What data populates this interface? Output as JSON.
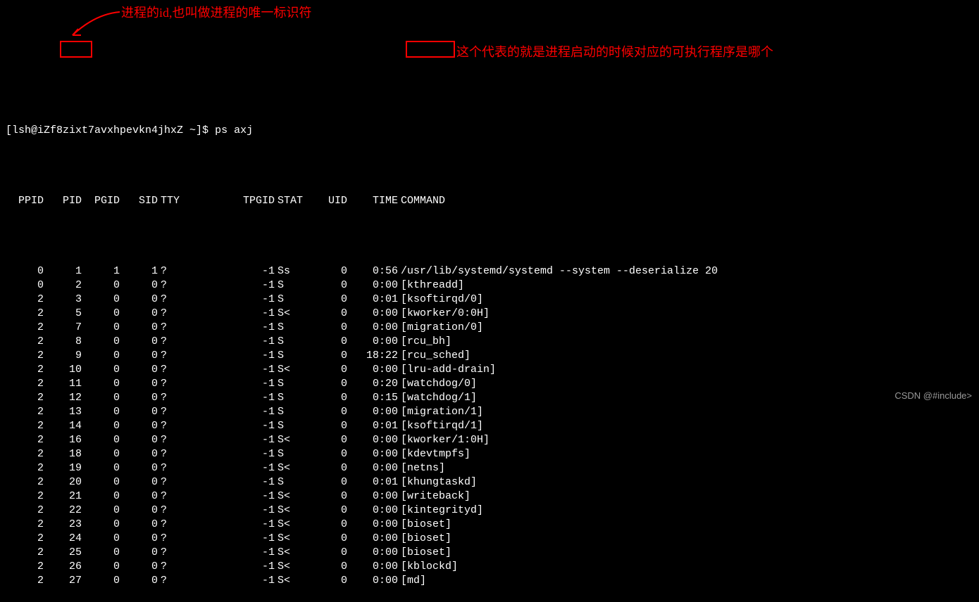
{
  "annotations": {
    "pid_note": "进程的id,也叫做进程的唯一标识符",
    "command_note": "这个代表的就是进程启动的时候对应的可执行程序是哪个"
  },
  "prompt": "[lsh@iZf8zixt7avxhpevkn4jhxZ ~]$ ",
  "command": "ps axj",
  "headers": {
    "ppid": "PPID",
    "pid": "PID",
    "pgid": "PGID",
    "sid": "SID",
    "tty": "TTY",
    "tpgid": "TPGID",
    "stat": "STAT",
    "uid": "UID",
    "time": "TIME",
    "cmd": "COMMAND"
  },
  "rows": [
    {
      "ppid": "0",
      "pid": "1",
      "pgid": "1",
      "sid": "1",
      "tty": "?",
      "tpgid": "-1",
      "stat": "Ss",
      "uid": "0",
      "time": "0:56",
      "cmd": "/usr/lib/systemd/systemd --system --deserialize 20"
    },
    {
      "ppid": "0",
      "pid": "2",
      "pgid": "0",
      "sid": "0",
      "tty": "?",
      "tpgid": "-1",
      "stat": "S",
      "uid": "0",
      "time": "0:00",
      "cmd": "[kthreadd]"
    },
    {
      "ppid": "2",
      "pid": "3",
      "pgid": "0",
      "sid": "0",
      "tty": "?",
      "tpgid": "-1",
      "stat": "S",
      "uid": "0",
      "time": "0:01",
      "cmd": "[ksoftirqd/0]"
    },
    {
      "ppid": "2",
      "pid": "5",
      "pgid": "0",
      "sid": "0",
      "tty": "?",
      "tpgid": "-1",
      "stat": "S<",
      "uid": "0",
      "time": "0:00",
      "cmd": "[kworker/0:0H]"
    },
    {
      "ppid": "2",
      "pid": "7",
      "pgid": "0",
      "sid": "0",
      "tty": "?",
      "tpgid": "-1",
      "stat": "S",
      "uid": "0",
      "time": "0:00",
      "cmd": "[migration/0]"
    },
    {
      "ppid": "2",
      "pid": "8",
      "pgid": "0",
      "sid": "0",
      "tty": "?",
      "tpgid": "-1",
      "stat": "S",
      "uid": "0",
      "time": "0:00",
      "cmd": "[rcu_bh]"
    },
    {
      "ppid": "2",
      "pid": "9",
      "pgid": "0",
      "sid": "0",
      "tty": "?",
      "tpgid": "-1",
      "stat": "S",
      "uid": "0",
      "time": "18:22",
      "cmd": "[rcu_sched]"
    },
    {
      "ppid": "2",
      "pid": "10",
      "pgid": "0",
      "sid": "0",
      "tty": "?",
      "tpgid": "-1",
      "stat": "S<",
      "uid": "0",
      "time": "0:00",
      "cmd": "[lru-add-drain]"
    },
    {
      "ppid": "2",
      "pid": "11",
      "pgid": "0",
      "sid": "0",
      "tty": "?",
      "tpgid": "-1",
      "stat": "S",
      "uid": "0",
      "time": "0:20",
      "cmd": "[watchdog/0]"
    },
    {
      "ppid": "2",
      "pid": "12",
      "pgid": "0",
      "sid": "0",
      "tty": "?",
      "tpgid": "-1",
      "stat": "S",
      "uid": "0",
      "time": "0:15",
      "cmd": "[watchdog/1]"
    },
    {
      "ppid": "2",
      "pid": "13",
      "pgid": "0",
      "sid": "0",
      "tty": "?",
      "tpgid": "-1",
      "stat": "S",
      "uid": "0",
      "time": "0:00",
      "cmd": "[migration/1]"
    },
    {
      "ppid": "2",
      "pid": "14",
      "pgid": "0",
      "sid": "0",
      "tty": "?",
      "tpgid": "-1",
      "stat": "S",
      "uid": "0",
      "time": "0:01",
      "cmd": "[ksoftirqd/1]"
    },
    {
      "ppid": "2",
      "pid": "16",
      "pgid": "0",
      "sid": "0",
      "tty": "?",
      "tpgid": "-1",
      "stat": "S<",
      "uid": "0",
      "time": "0:00",
      "cmd": "[kworker/1:0H]"
    },
    {
      "ppid": "2",
      "pid": "18",
      "pgid": "0",
      "sid": "0",
      "tty": "?",
      "tpgid": "-1",
      "stat": "S",
      "uid": "0",
      "time": "0:00",
      "cmd": "[kdevtmpfs]"
    },
    {
      "ppid": "2",
      "pid": "19",
      "pgid": "0",
      "sid": "0",
      "tty": "?",
      "tpgid": "-1",
      "stat": "S<",
      "uid": "0",
      "time": "0:00",
      "cmd": "[netns]"
    },
    {
      "ppid": "2",
      "pid": "20",
      "pgid": "0",
      "sid": "0",
      "tty": "?",
      "tpgid": "-1",
      "stat": "S",
      "uid": "0",
      "time": "0:01",
      "cmd": "[khungtaskd]"
    },
    {
      "ppid": "2",
      "pid": "21",
      "pgid": "0",
      "sid": "0",
      "tty": "?",
      "tpgid": "-1",
      "stat": "S<",
      "uid": "0",
      "time": "0:00",
      "cmd": "[writeback]"
    },
    {
      "ppid": "2",
      "pid": "22",
      "pgid": "0",
      "sid": "0",
      "tty": "?",
      "tpgid": "-1",
      "stat": "S<",
      "uid": "0",
      "time": "0:00",
      "cmd": "[kintegrityd]"
    },
    {
      "ppid": "2",
      "pid": "23",
      "pgid": "0",
      "sid": "0",
      "tty": "?",
      "tpgid": "-1",
      "stat": "S<",
      "uid": "0",
      "time": "0:00",
      "cmd": "[bioset]"
    },
    {
      "ppid": "2",
      "pid": "24",
      "pgid": "0",
      "sid": "0",
      "tty": "?",
      "tpgid": "-1",
      "stat": "S<",
      "uid": "0",
      "time": "0:00",
      "cmd": "[bioset]"
    },
    {
      "ppid": "2",
      "pid": "25",
      "pgid": "0",
      "sid": "0",
      "tty": "?",
      "tpgid": "-1",
      "stat": "S<",
      "uid": "0",
      "time": "0:00",
      "cmd": "[bioset]"
    },
    {
      "ppid": "2",
      "pid": "26",
      "pgid": "0",
      "sid": "0",
      "tty": "?",
      "tpgid": "-1",
      "stat": "S<",
      "uid": "0",
      "time": "0:00",
      "cmd": "[kblockd]"
    },
    {
      "ppid": "2",
      "pid": "27",
      "pgid": "0",
      "sid": "0",
      "tty": "?",
      "tpgid": "-1",
      "stat": "S<",
      "uid": "0",
      "time": "0:00",
      "cmd": "[md]"
    }
  ],
  "watermark": "CSDN @#include>"
}
